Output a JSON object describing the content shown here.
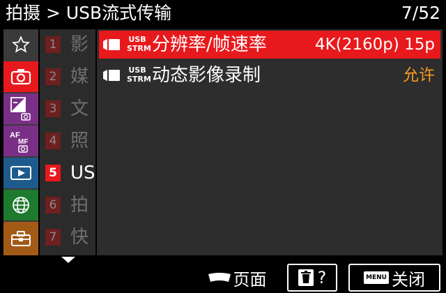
{
  "header": {
    "title": "拍摄 > USB流式传输",
    "page": "7/52"
  },
  "sidebar": {
    "items": [
      {
        "icon": "star-icon",
        "active": false,
        "color": "#3a3a3a"
      },
      {
        "icon": "camera-icon",
        "active": true,
        "color": "#e8191c"
      },
      {
        "icon": "exposure-icon",
        "active": false,
        "color": "#7a2f86"
      },
      {
        "icon": "af-mf-icon",
        "active": false,
        "color": "#7a2f86"
      },
      {
        "icon": "playback-icon",
        "active": false,
        "color": "#1e5b8c"
      },
      {
        "icon": "network-icon",
        "active": false,
        "color": "#1e7a2e"
      },
      {
        "icon": "toolbox-icon",
        "active": false,
        "color": "#a35a16"
      }
    ]
  },
  "sections": [
    {
      "number": "1",
      "label": "影"
    },
    {
      "number": "2",
      "label": "媒"
    },
    {
      "number": "3",
      "label": "文"
    },
    {
      "number": "4",
      "label": "照"
    },
    {
      "number": "5",
      "label": "US"
    },
    {
      "number": "6",
      "label": "拍"
    },
    {
      "number": "7",
      "label": "快"
    }
  ],
  "menu": {
    "rows": [
      {
        "badge_top": "USB",
        "badge_bottom": "STRM",
        "label": "分辨率/帧速率",
        "value": "4K(2160p) 15p",
        "selected": true
      },
      {
        "badge_top": "USB",
        "badge_bottom": "STRM",
        "label": "动态影像录制",
        "value": "允许",
        "selected": false
      }
    ]
  },
  "footer": {
    "page_label": "页面",
    "help_label": "?",
    "menu_key": "MENU",
    "close_label": "关闭"
  },
  "colors": {
    "accent": "#e8191c",
    "value_orange": "#f39a1e"
  }
}
